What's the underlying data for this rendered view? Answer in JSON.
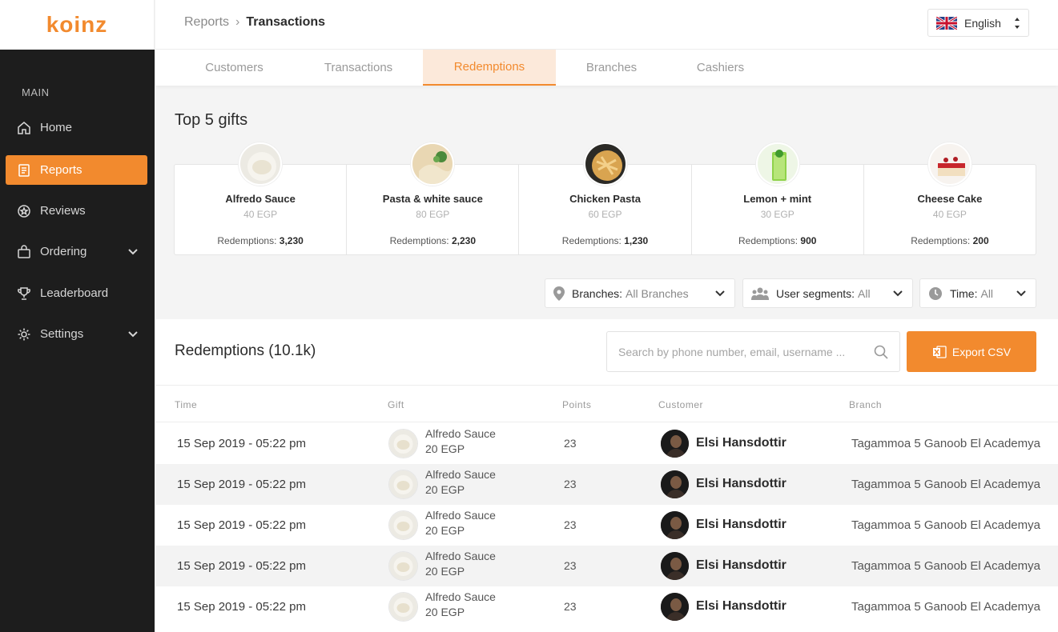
{
  "app": {
    "logo": "koinz"
  },
  "sidebar": {
    "section_label": "MAIN",
    "items": [
      {
        "label": "Home",
        "icon": "home-icon"
      },
      {
        "label": "Reports",
        "icon": "report-icon",
        "active": true
      },
      {
        "label": "Reviews",
        "icon": "reviews-icon"
      },
      {
        "label": "Ordering",
        "icon": "bag-icon",
        "expandable": true
      },
      {
        "label": "Leaderboard",
        "icon": "trophy-icon"
      },
      {
        "label": "Settings",
        "icon": "gear-icon",
        "expandable": true
      }
    ]
  },
  "header": {
    "breadcrumb_root": "Reports",
    "breadcrumb_sep": "›",
    "breadcrumb_current": "Transactions",
    "language": "English"
  },
  "tabs": [
    {
      "label": "Customers"
    },
    {
      "label": "Transactions"
    },
    {
      "label": "Redemptions",
      "active": true
    },
    {
      "label": "Branches"
    },
    {
      "label": "Cashiers"
    }
  ],
  "top_gifts": {
    "title": "Top 5 gifts",
    "redemptions_label": "Redemptions:",
    "items": [
      {
        "name": "Alfredo Sauce",
        "price": "40 EGP",
        "redemptions": "3,230"
      },
      {
        "name": "Pasta & white sauce",
        "price": "80 EGP",
        "redemptions": "2,230"
      },
      {
        "name": "Chicken Pasta",
        "price": "60 EGP",
        "redemptions": "1,230"
      },
      {
        "name": "Lemon + mint",
        "price": "30 EGP",
        "redemptions": "900"
      },
      {
        "name": "Cheese Cake",
        "price": "40 EGP",
        "redemptions": "200"
      }
    ]
  },
  "filters": {
    "branches": {
      "label": "Branches:",
      "value": "All Branches"
    },
    "segments": {
      "label": "User segments:",
      "value": "All"
    },
    "time": {
      "label": "Time:",
      "value": "All"
    }
  },
  "redemptions": {
    "title": "Redemptions (10.1k)",
    "search_placeholder": "Search by phone number, email, username ...",
    "export_label": "Export CSV",
    "columns": {
      "time": "Time",
      "gift": "Gift",
      "points": "Points",
      "customer": "Customer",
      "branch": "Branch"
    },
    "rows": [
      {
        "time": "15 Sep 2019 - 05:22 pm",
        "gift": "Alfredo Sauce",
        "price": "20 EGP",
        "points": "23",
        "customer": "Elsi Hansdottir",
        "branch": "Tagammoa 5 Ganoob El Academya"
      },
      {
        "time": "15 Sep 2019 - 05:22 pm",
        "gift": "Alfredo Sauce",
        "price": "20 EGP",
        "points": "23",
        "customer": "Elsi Hansdottir",
        "branch": "Tagammoa 5 Ganoob El Academya"
      },
      {
        "time": "15 Sep 2019 - 05:22 pm",
        "gift": "Alfredo Sauce",
        "price": "20 EGP",
        "points": "23",
        "customer": "Elsi Hansdottir",
        "branch": "Tagammoa 5 Ganoob El Academya"
      },
      {
        "time": "15 Sep 2019 - 05:22 pm",
        "gift": "Alfredo Sauce",
        "price": "20 EGP",
        "points": "23",
        "customer": "Elsi Hansdottir",
        "branch": "Tagammoa 5 Ganoob El Academya"
      },
      {
        "time": "15 Sep 2019 - 05:22 pm",
        "gift": "Alfredo Sauce",
        "price": "20 EGP",
        "points": "23",
        "customer": "Elsi Hansdottir",
        "branch": "Tagammoa 5 Ganoob El Academya"
      }
    ]
  },
  "colors": {
    "accent": "#f28a2e",
    "accent_light": "#fce9da",
    "sidebar_bg": "#1d1d1d"
  }
}
